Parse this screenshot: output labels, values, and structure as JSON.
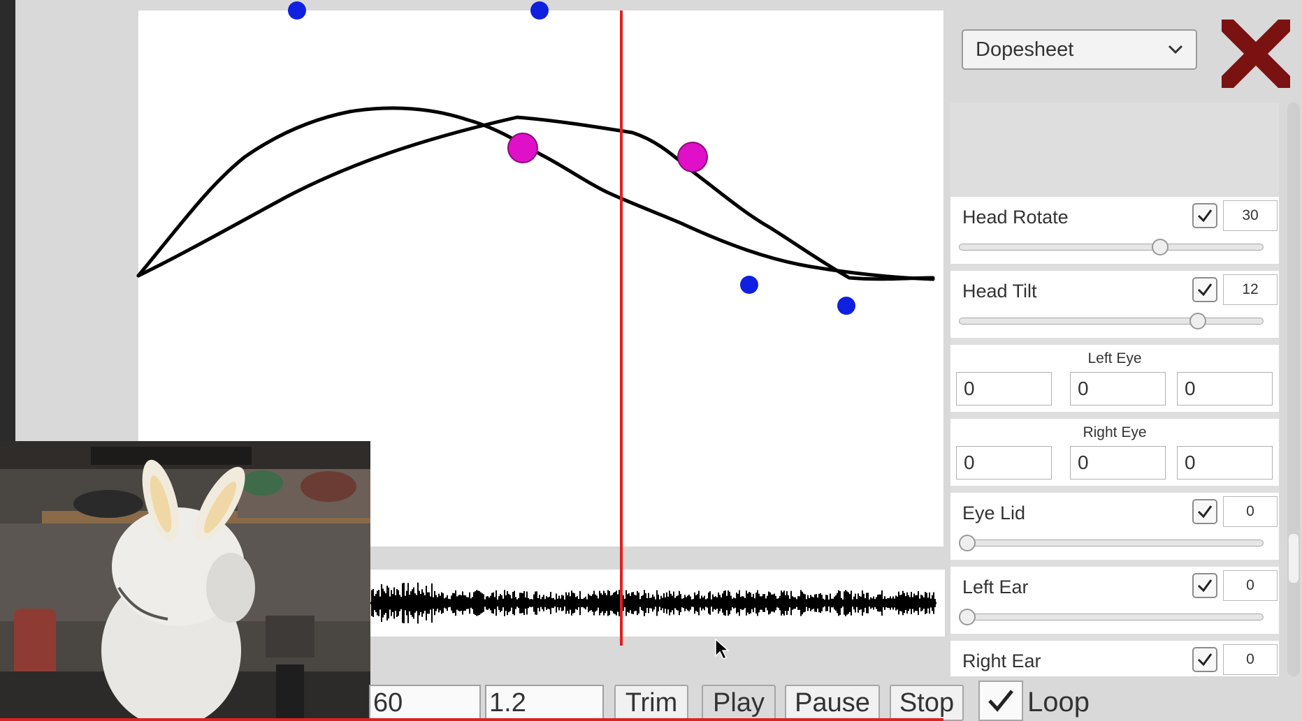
{
  "timeline": {
    "keyframes_label": "keyframe-handles"
  },
  "panel": {
    "mode": "Dopesheet",
    "head_rotate": {
      "label": "Head Rotate",
      "checked": true,
      "value": "30",
      "slider": 0.67
    },
    "head_tilt": {
      "label": "Head Tilt",
      "checked": true,
      "value": "12",
      "slider": 0.8
    },
    "left_eye": {
      "label": "Left Eye",
      "x": "0",
      "y": "0",
      "z": "0"
    },
    "right_eye": {
      "label": "Right Eye",
      "x": "0",
      "y": "0",
      "z": "0"
    },
    "eye_lid": {
      "label": "Eye Lid",
      "checked": true,
      "value": "0",
      "slider": 0.0
    },
    "left_ear": {
      "label": "Left Ear",
      "checked": true,
      "value": "0",
      "slider": 0.0
    },
    "right_ear": {
      "label": "Right Ear",
      "checked": true,
      "value": "0"
    }
  },
  "bottom": {
    "fps": "60",
    "length": "1.2",
    "trim": "Trim",
    "play": "Play",
    "pause": "Pause",
    "stop": "Stop",
    "loop": "Loop",
    "loop_checked": true
  },
  "colors": {
    "playhead": "#e02020",
    "keyframe": "#e010c8",
    "handle": "#1020e0",
    "close": "#7a1212"
  }
}
